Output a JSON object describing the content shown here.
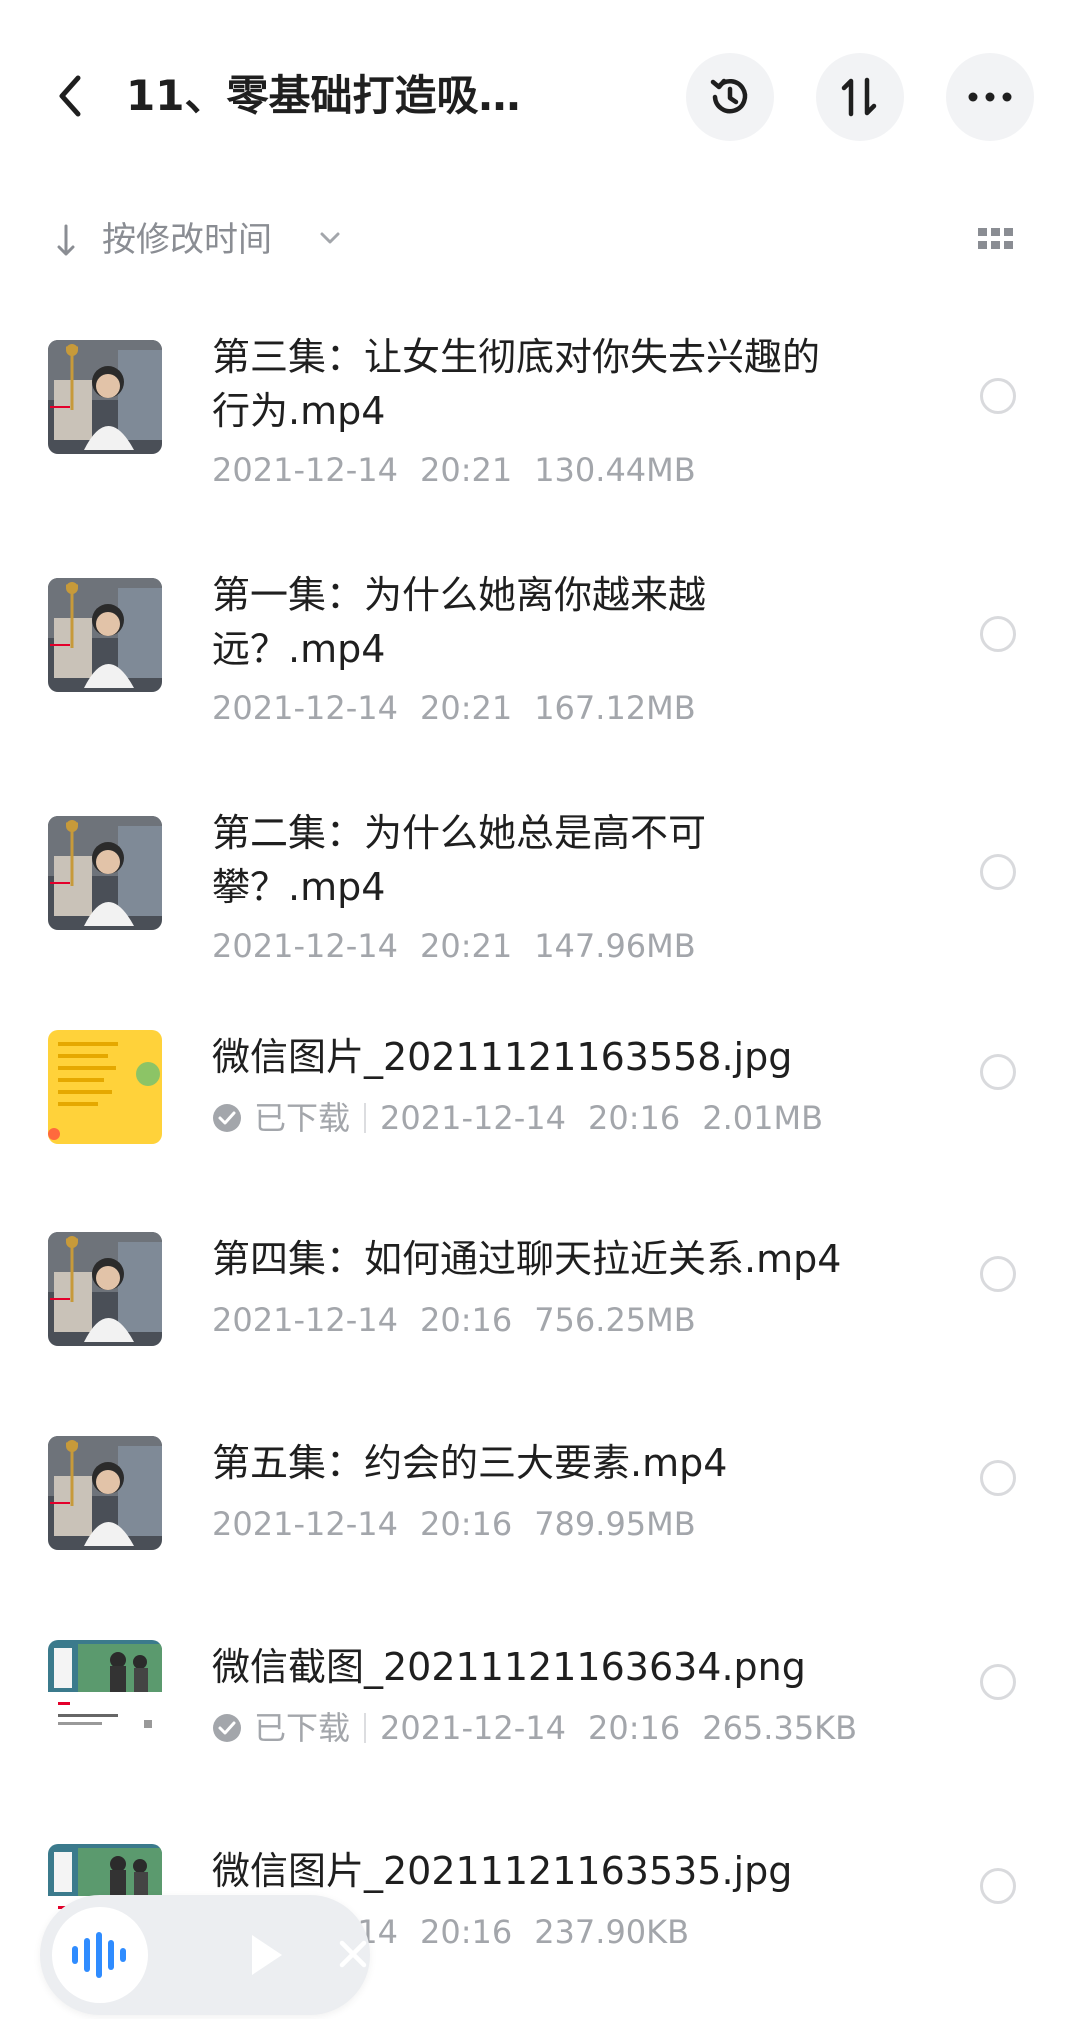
{
  "header": {
    "title": "11、零基础打造吸…"
  },
  "sortbar": {
    "label": "按修改时间"
  },
  "files": [
    {
      "name": "第三集：让女生彻底对你失去兴趣的行为.mp4",
      "date": "2021-12-14",
      "time": "20:21",
      "size": "130.44MB",
      "downloaded": false,
      "thumb": "video"
    },
    {
      "name": "第一集：为什么她离你越来越远？.mp4",
      "date": "2021-12-14",
      "time": "20:21",
      "size": "167.12MB",
      "downloaded": false,
      "thumb": "video"
    },
    {
      "name": "第二集：为什么她总是高不可攀？.mp4",
      "date": "2021-12-14",
      "time": "20:21",
      "size": "147.96MB",
      "downloaded": false,
      "thumb": "video"
    },
    {
      "name": "微信图片_20211121163558.jpg",
      "status": "已下载",
      "date": "2021-12-14",
      "time": "20:16",
      "size": "2.01MB",
      "downloaded": true,
      "thumb": "yellow-image"
    },
    {
      "name": "第四集：如何通过聊天拉近关系.mp4",
      "date": "2021-12-14",
      "time": "20:16",
      "size": "756.25MB",
      "downloaded": false,
      "thumb": "video"
    },
    {
      "name": "第五集：约会的三大要素.mp4",
      "date": "2021-12-14",
      "time": "20:16",
      "size": "789.95MB",
      "downloaded": false,
      "thumb": "video"
    },
    {
      "name": "微信截图_20211121163634.png",
      "status": "已下载",
      "date": "2021-12-14",
      "time": "20:16",
      "size": "265.35KB",
      "downloaded": true,
      "thumb": "screenshot"
    },
    {
      "name": "微信图片_20211121163535.jpg",
      "date": "2021-12-14",
      "time": "20:16",
      "size": "237.90KB",
      "downloaded": false,
      "thumb": "screenshot"
    }
  ],
  "icons": {
    "back": "chevron-left-icon",
    "history": "history-icon",
    "sort": "sort-icon",
    "more": "more-icon",
    "grid": "grid-icon",
    "audio": "audio-wave-icon",
    "play": "play-icon",
    "close": "close-icon"
  },
  "colors": {
    "accent": "#2f8cff",
    "muted_text": "#a3a6ab",
    "header_button_bg": "#f2f3f5"
  }
}
